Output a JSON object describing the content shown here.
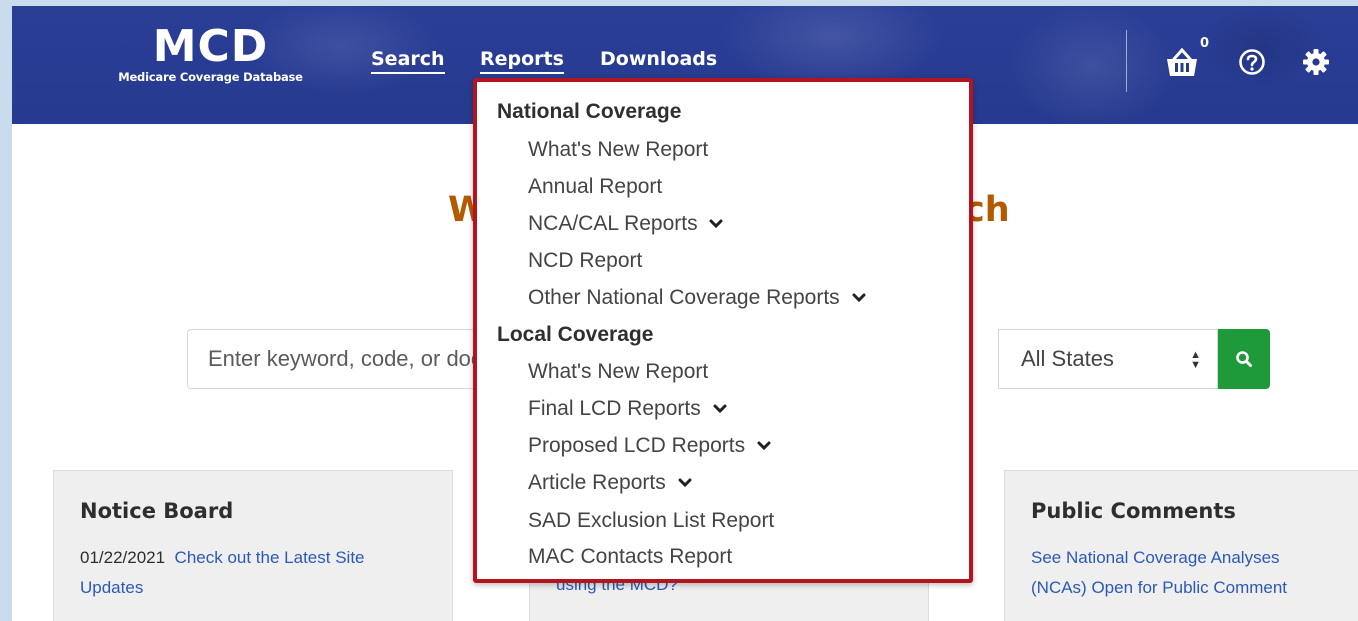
{
  "header": {
    "logo_title": "MCD",
    "logo_subtitle": "Medicare Coverage Database",
    "nav": {
      "search": "Search",
      "reports": "Reports",
      "downloads": "Downloads"
    },
    "basket_count": "0",
    "icons": [
      "basket-icon",
      "help-icon",
      "gear-icon"
    ]
  },
  "main": {
    "welcome_start": "W",
    "welcome_end": "ch",
    "search": {
      "placeholder": "Enter keyword, code, or document ID",
      "value": ""
    },
    "state_select": {
      "selected": "All States"
    },
    "search_button_icon": "search-icon"
  },
  "reports_menu": {
    "national_heading": "National Coverage",
    "national_items": [
      {
        "label": "What's New Report",
        "has_submenu": false
      },
      {
        "label": "Annual Report",
        "has_submenu": false
      },
      {
        "label": "NCA/CAL Reports",
        "has_submenu": true
      },
      {
        "label": "NCD Report",
        "has_submenu": false
      },
      {
        "label": "Other National Coverage Reports",
        "has_submenu": true
      }
    ],
    "local_heading": "Local Coverage",
    "local_items": [
      {
        "label": "What's New Report",
        "has_submenu": false
      },
      {
        "label": "Final LCD Reports",
        "has_submenu": true
      },
      {
        "label": "Proposed LCD Reports",
        "has_submenu": true
      },
      {
        "label": "Article Reports",
        "has_submenu": true
      },
      {
        "label": "SAD Exclusion List Report",
        "has_submenu": false
      },
      {
        "label": "MAC Contacts Report",
        "has_submenu": false
      }
    ]
  },
  "cards": {
    "notice_board": {
      "title": "Notice Board",
      "date": "01/22/2021",
      "link_line1": "Check out the Latest Site",
      "link_line2": "Updates"
    },
    "middle": {
      "partial_link": "using the MCD?"
    },
    "public_comments": {
      "title": "Public Comments",
      "link_line1": "See National Coverage Analyses",
      "link_line2": "(NCAs) Open for Public Comment"
    }
  },
  "colors": {
    "header_bg": "#263a8f",
    "accent_orange": "#b35a00",
    "highlight_red": "#b3141d",
    "search_green": "#1f9a3a",
    "link_blue": "#2b59b5"
  }
}
